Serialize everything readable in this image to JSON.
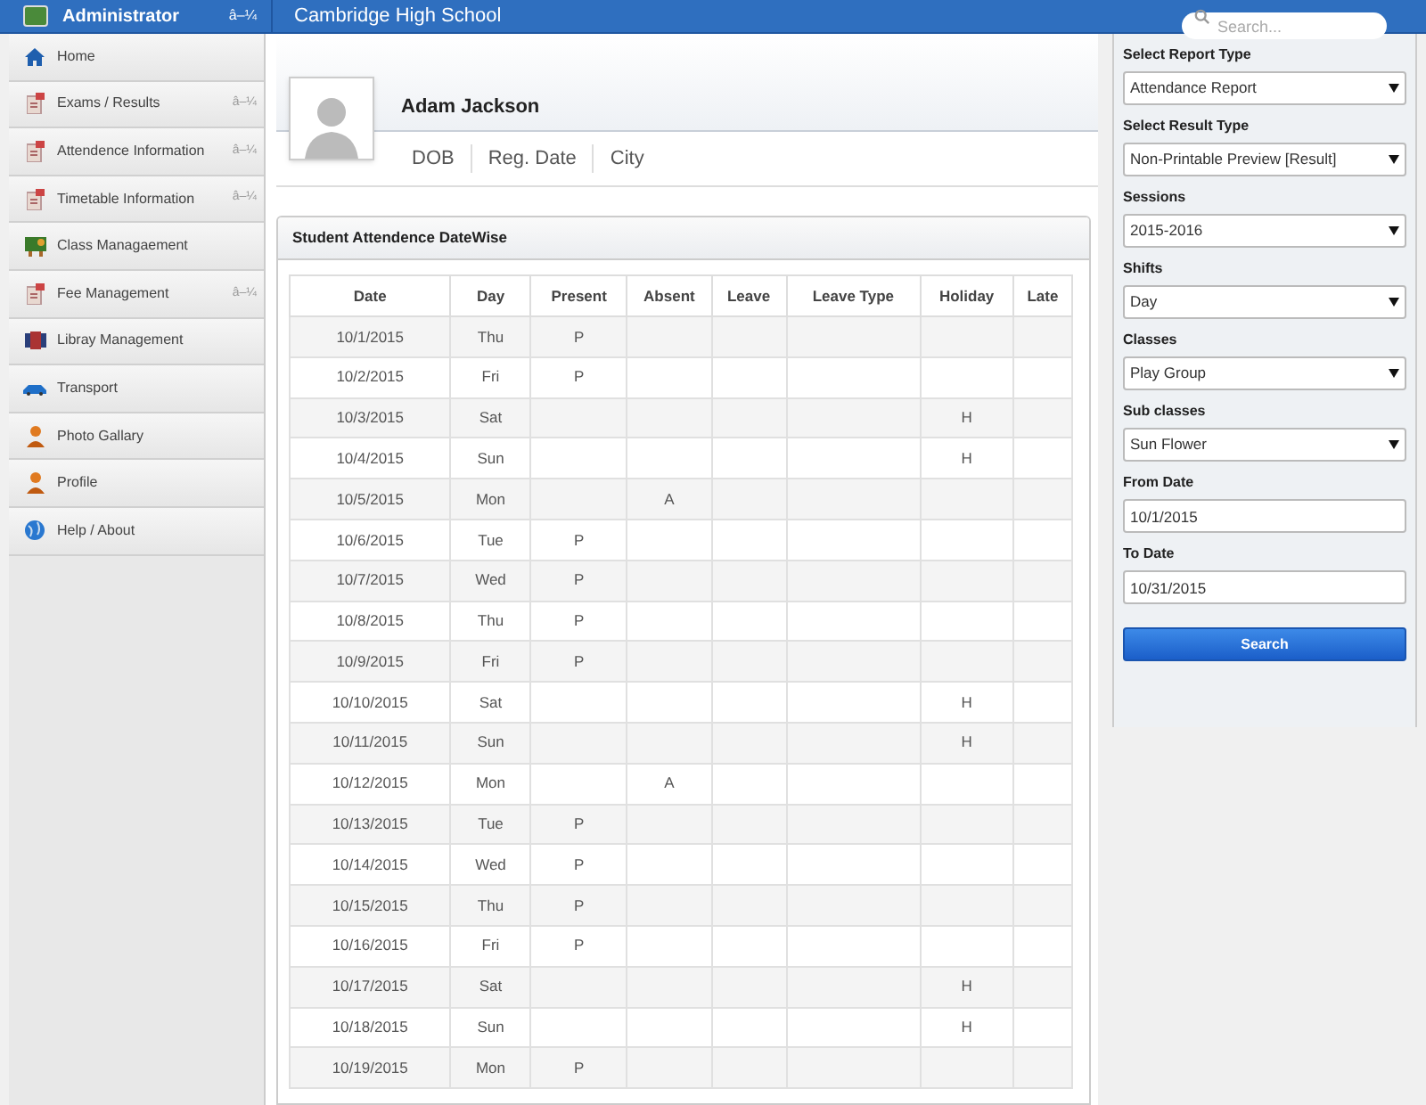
{
  "header": {
    "user": "Administrator",
    "user_caret": "â–¼",
    "school": "Cambridge High School",
    "search": {
      "placeholder": "Search..."
    }
  },
  "sidebar": {
    "items": [
      {
        "label": "Home"
      },
      {
        "label": "Exams / Results",
        "caret": "â–¼"
      },
      {
        "label": "Attendence Information",
        "caret": "â–¼"
      },
      {
        "label": "Timetable Information",
        "caret": "â–¼"
      },
      {
        "label": "Class Managaement"
      },
      {
        "label": "Fee Management",
        "caret": "â–¼"
      },
      {
        "label": "Libray Management"
      },
      {
        "label": "Transport"
      },
      {
        "label": "Photo Gallary"
      },
      {
        "label": "Profile"
      },
      {
        "label": "Help / About"
      }
    ]
  },
  "profile": {
    "name": "Adam Jackson",
    "fields": [
      "DOB",
      "Reg. Date",
      "City"
    ]
  },
  "attendance": {
    "title": "Student Attendence DateWise",
    "columns": [
      "Date",
      "Day",
      "Present",
      "Absent",
      "Leave",
      "Leave Type",
      "Holiday",
      "Late"
    ],
    "rows": [
      {
        "date": "10/1/2015",
        "day": "Thu",
        "present": "P"
      },
      {
        "date": "10/2/2015",
        "day": "Fri",
        "present": "P"
      },
      {
        "date": "10/3/2015",
        "day": "Sat",
        "holiday": "H"
      },
      {
        "date": "10/4/2015",
        "day": "Sun",
        "holiday": "H"
      },
      {
        "date": "10/5/2015",
        "day": "Mon",
        "absent": "A"
      },
      {
        "date": "10/6/2015",
        "day": "Tue",
        "present": "P"
      },
      {
        "date": "10/7/2015",
        "day": "Wed",
        "present": "P"
      },
      {
        "date": "10/8/2015",
        "day": "Thu",
        "present": "P"
      },
      {
        "date": "10/9/2015",
        "day": "Fri",
        "present": "P"
      },
      {
        "date": "10/10/2015",
        "day": "Sat",
        "holiday": "H"
      },
      {
        "date": "10/11/2015",
        "day": "Sun",
        "holiday": "H"
      },
      {
        "date": "10/12/2015",
        "day": "Mon",
        "absent": "A"
      },
      {
        "date": "10/13/2015",
        "day": "Tue",
        "present": "P"
      },
      {
        "date": "10/14/2015",
        "day": "Wed",
        "present": "P"
      },
      {
        "date": "10/15/2015",
        "day": "Thu",
        "present": "P"
      },
      {
        "date": "10/16/2015",
        "day": "Fri",
        "present": "P"
      },
      {
        "date": "10/17/2015",
        "day": "Sat",
        "holiday": "H"
      },
      {
        "date": "10/18/2015",
        "day": "Sun",
        "holiday": "H"
      },
      {
        "date": "10/19/2015",
        "day": "Mon",
        "present": "P"
      }
    ]
  },
  "filters": {
    "fields": [
      {
        "label": "Select Report Type",
        "kind": "select",
        "value": "Attendance Report"
      },
      {
        "label": "Select Result Type",
        "kind": "select",
        "value": "Non-Printable Preview [Result]"
      },
      {
        "label": "Sessions",
        "kind": "select",
        "value": "2015-2016"
      },
      {
        "label": "Shifts",
        "kind": "select",
        "value": "Day"
      },
      {
        "label": "Classes",
        "kind": "select",
        "value": "Play Group"
      },
      {
        "label": "Sub classes",
        "kind": "select",
        "value": "Sun Flower"
      },
      {
        "label": "From Date",
        "kind": "date",
        "value": "10/1/2015"
      },
      {
        "label": "To Date",
        "kind": "date",
        "value": "10/31/2015"
      }
    ],
    "button": "Search"
  }
}
